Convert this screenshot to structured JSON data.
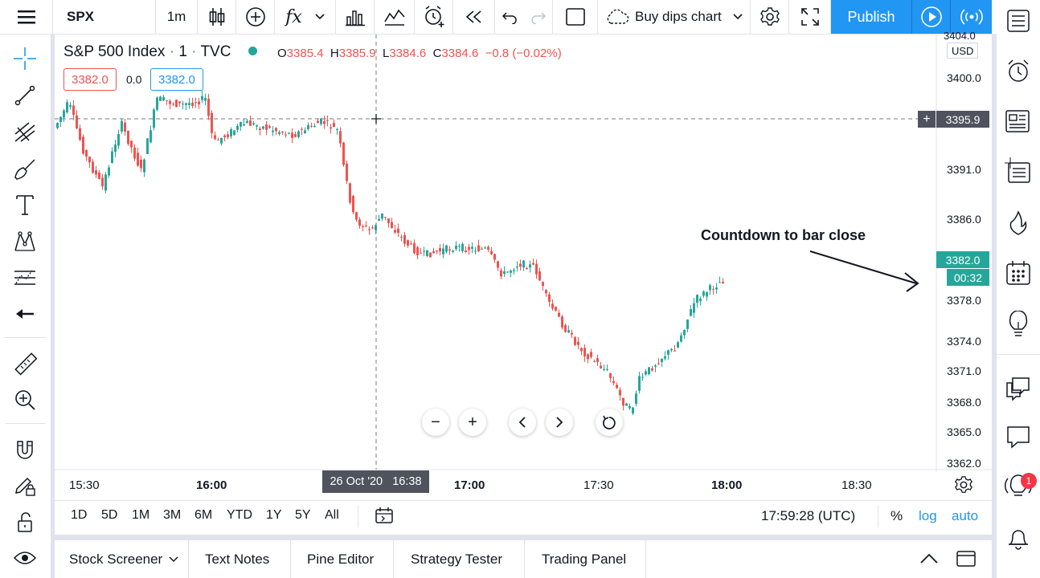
{
  "topbar": {
    "symbol": "SPX",
    "interval": "1m",
    "layout_name": "Buy dips chart",
    "publish": "Publish",
    "icons": [
      "candles-icon",
      "add-compare-icon",
      "indicators-icon",
      "financials-icon",
      "templates-icon",
      "alert-icon",
      "replay-icon",
      "undo-icon",
      "redo-icon",
      "select-layout-icon",
      "cloud-icon",
      "chevron-down-icon",
      "settings-gear-icon",
      "fullscreen-icon",
      "play-icon",
      "broadcast-icon"
    ]
  },
  "legend": {
    "name": "S&P 500 Index",
    "dot1": "·",
    "interval": "1",
    "dot2": "·",
    "exchange": "TVC",
    "o_label": "O",
    "o_value": "3385.4",
    "h_label": "H",
    "h_value": "3385.9",
    "l_label": "L",
    "l_value": "3384.6",
    "c_label": "C",
    "c_value": "3384.6",
    "change": "−0.8 (−0.02%)",
    "sell": "3382.0",
    "spread": "0.0",
    "buy": "3382.0"
  },
  "price_axis": {
    "currency": "USD",
    "ticks": [
      "3404.0",
      "3400.0",
      "3391.0",
      "3386.0",
      "3378.0",
      "3374.0",
      "3371.0",
      "3368.0",
      "3365.0",
      "3362.0"
    ],
    "crosshair_price": "3395.9",
    "last_price": "3382.0",
    "countdown": "00:32"
  },
  "time_axis": {
    "ticks": [
      "15:30",
      "16:00",
      "17:00",
      "17:30",
      "18:00",
      "18:30"
    ],
    "crosshair_label_date": "26 Oct '20",
    "crosshair_label_time": "16:38"
  },
  "annotation": {
    "text": "Countdown to bar close"
  },
  "ranges": [
    "1D",
    "5D",
    "1M",
    "3M",
    "6M",
    "YTD",
    "1Y",
    "5Y",
    "All"
  ],
  "clock": "17:59:28 (UTC)",
  "scale_toggles": {
    "percent": "%",
    "log": "log",
    "auto": "auto"
  },
  "bottom_tabs": [
    "Stock Screener",
    "Text Notes",
    "Pine Editor",
    "Strategy Tester",
    "Trading Panel"
  ],
  "notification_count": "1",
  "colors": {
    "up": "#26a69a",
    "down": "#ef5350",
    "accent": "#2196f3",
    "price_label": "#26a69a",
    "crosshair_label": "#50535e"
  }
}
